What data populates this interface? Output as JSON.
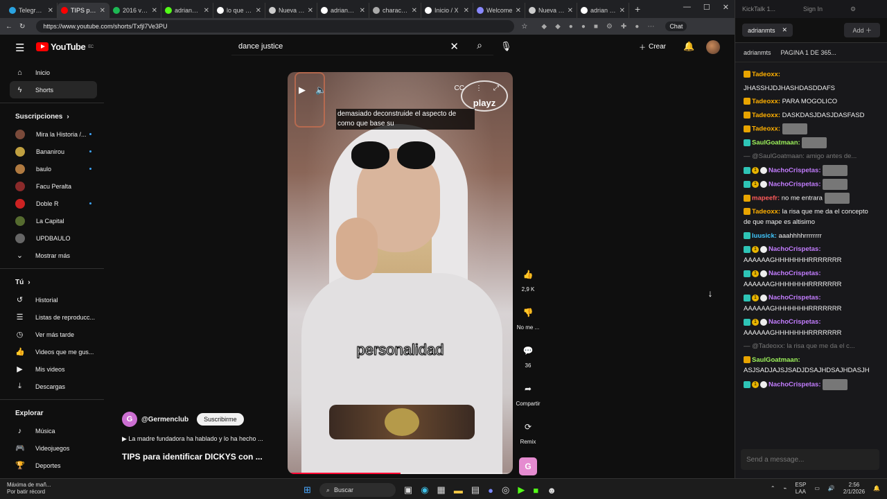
{
  "browser": {
    "tabs": [
      {
        "label": "Telegram W",
        "color": "#2aa3e0"
      },
      {
        "label": "TIPS para id",
        "color": "#ff0000",
        "active": true
      },
      {
        "label": "2016 vibes",
        "color": "#1db954"
      },
      {
        "label": "adrianmts",
        "color": "#53fc18"
      },
      {
        "label": "lo que te p",
        "color": "#ffffff"
      },
      {
        "label": "Nueva pest",
        "color": "#cccccc"
      },
      {
        "label": "adrianmts",
        "color": "#ffffff"
      },
      {
        "label": "character.a",
        "color": "#aaaaaa"
      },
      {
        "label": "Inicio / X",
        "color": "#ffffff"
      },
      {
        "label": "Welcome",
        "color": "#8888ff"
      },
      {
        "label": "Nueva pest",
        "color": "#cccccc"
      },
      {
        "label": "adrian - 7T",
        "color": "#ffffff"
      }
    ],
    "url": "https://www.youtube.com/shorts/Txfjl7Ve3PU",
    "chat_label": "Chat"
  },
  "youtube": {
    "logo_text": "YouTube",
    "logo_region": "EC",
    "search_value": "dance justice",
    "create_label": "Crear",
    "sidebar": {
      "main": [
        {
          "label": "Inicio",
          "icon": "home-icon"
        },
        {
          "label": "Shorts",
          "icon": "shorts-icon"
        }
      ],
      "subs_header": "Suscripciones",
      "subs": [
        {
          "label": "Mira la Historia /...",
          "color": "#7a4a3a",
          "dot": true
        },
        {
          "label": "Bananirou",
          "color": "#c0a040",
          "dot": true
        },
        {
          "label": "baulo",
          "color": "#b07a40",
          "dot": true
        },
        {
          "label": "Facu Peralta",
          "color": "#8a2a2a",
          "dot": false
        },
        {
          "label": "Doble R",
          "color": "#cc2222",
          "dot": true
        },
        {
          "label": "La Capital",
          "color": "#556b2f",
          "dot": false
        },
        {
          "label": "UPDBAULO",
          "color": "#666666",
          "dot": false
        }
      ],
      "more_label": "Mostrar más",
      "you_header": "Tú",
      "you": [
        {
          "label": "Historial",
          "icon": "history-icon"
        },
        {
          "label": "Listas de reproducc...",
          "icon": "playlist-icon"
        },
        {
          "label": "Ver más tarde",
          "icon": "watch-later-icon"
        },
        {
          "label": "Videos que me gus...",
          "icon": "like-icon"
        },
        {
          "label": "Mis videos",
          "icon": "my-videos-icon"
        },
        {
          "label": "Descargas",
          "icon": "download-icon"
        }
      ],
      "explore_header": "Explorar",
      "explore": [
        {
          "label": "Música",
          "icon": "music-icon"
        },
        {
          "label": "Videojuegos",
          "icon": "gaming-icon"
        },
        {
          "label": "Deportes",
          "icon": "sports-icon"
        }
      ]
    },
    "short": {
      "caption_text": "demasiado deconstruide el aspecto de como que base su",
      "brand_text": "playz",
      "subtitle": "personalidad",
      "progress": 0.5,
      "likes": "2,9 K",
      "dislike_label": "No me ...",
      "comments": "36",
      "share_label": "Compartir",
      "remix_label": "Remix",
      "channel": "@Germenclub",
      "subscribe_label": "Suscribirme",
      "music_line": "La madre fundadora ha hablado y lo ha hecho ...",
      "title": "TIPS para identificar DICKYS con ..."
    }
  },
  "kick": {
    "header_label": "KickTalk 1...",
    "signin_label": "Sign In",
    "tab_label": "adrianmts",
    "add_label": "Add",
    "channel": "adrianmts",
    "page_info": "PAGINA 1 DE 365...",
    "messages": [
      {
        "user": "Tadeoxx:",
        "cls": "u-orange",
        "text": "",
        "badges": [
          "crown"
        ],
        "cut": true
      },
      {
        "user": "",
        "cls": "",
        "text": "JHASSHJDJHASHDASDDAFS",
        "badges": []
      },
      {
        "user": "Tadeoxx:",
        "cls": "u-orange",
        "text": "PARA MOGOLICO",
        "badges": [
          "crown"
        ]
      },
      {
        "user": "Tadeoxx:",
        "cls": "u-orange",
        "text": "DASKDASJDASJDASFASD",
        "badges": [
          "crown"
        ]
      },
      {
        "user": "Tadeoxx:",
        "cls": "u-orange",
        "text": "",
        "badges": [
          "crown"
        ],
        "emote": true
      },
      {
        "user": "SaulGoatmaan:",
        "cls": "u-green",
        "text": "",
        "badges": [
          "green"
        ],
        "emote": true
      },
      {
        "reply": "@SaulGoatmaan: amigo antes de..."
      },
      {
        "user": "NachoCrispetas:",
        "cls": "u-purple",
        "text": "",
        "badges": [
          "green",
          "num",
          "wolf"
        ],
        "emote": true
      },
      {
        "user": "NachoCrispetas:",
        "cls": "u-purple",
        "text": "",
        "badges": [
          "green",
          "num",
          "wolf"
        ],
        "emote": true
      },
      {
        "user": "mapeefr:",
        "cls": "u-red",
        "text": "no me entrara",
        "badges": [
          "crown"
        ],
        "emote": true
      },
      {
        "user": "Tadeoxx:",
        "cls": "u-orange",
        "text": "la risa que me da el concepto de que mape es altisimo",
        "badges": [
          "crown"
        ]
      },
      {
        "user": "luusick:",
        "cls": "u-cyan",
        "text": "aaahhhhrrrrrrrr",
        "badges": [
          "pencil"
        ]
      },
      {
        "user": "NachoCrispetas:",
        "cls": "u-purple",
        "text": "AAAAAAGHHHHHHHRRRRRRR",
        "badges": [
          "green",
          "num",
          "wolf"
        ]
      },
      {
        "user": "NachoCrispetas:",
        "cls": "u-purple",
        "text": "AAAAAAGHHHHHHHRRRRRRR",
        "badges": [
          "green",
          "num",
          "wolf"
        ]
      },
      {
        "user": "NachoCrispetas:",
        "cls": "u-purple",
        "text": "AAAAAAGHHHHHHHRRRRRRR",
        "badges": [
          "green",
          "num",
          "wolf"
        ]
      },
      {
        "user": "NachoCrispetas:",
        "cls": "u-purple",
        "text": "AAAAAAGHHHHHHHRRRRRRR",
        "badges": [
          "green",
          "num",
          "wolf"
        ]
      },
      {
        "reply": "@Tadeoxx: la risa que me da el c..."
      },
      {
        "user": "SaulGoatmaan:",
        "cls": "u-green",
        "text": "ASJSADJAJSJSADJDSAJHDSAJHDASJH",
        "badges": [
          "crown"
        ]
      },
      {
        "user": "NachoCrispetas:",
        "cls": "u-purple",
        "text": "",
        "badges": [
          "green",
          "num",
          "wolf"
        ],
        "emote": true
      }
    ],
    "input_placeholder": "Send a message..."
  },
  "taskbar": {
    "weather_line1": "Máxima de mañ...",
    "weather_line2": "Por batir récord",
    "search_label": "Buscar",
    "lang1": "ESP",
    "lang2": "LAA",
    "time": "2:56",
    "date": "2/1/2026"
  }
}
